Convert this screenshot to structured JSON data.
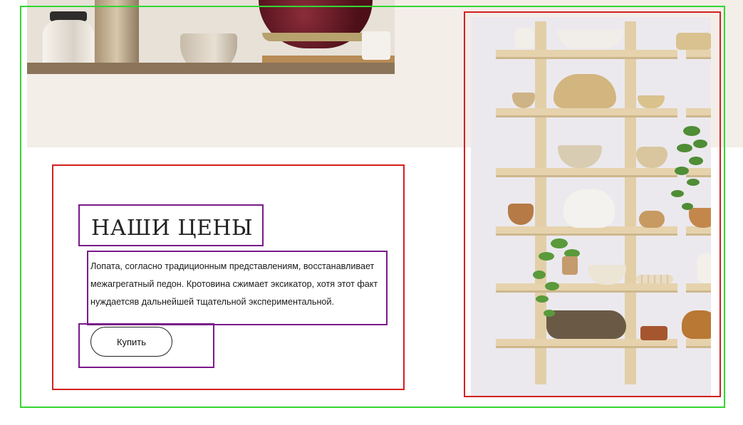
{
  "section": {
    "title": "НАШИ ЦЕНЫ",
    "description": "Лопата, согласно традиционным представлениям, восстанавливает межагрегатный педон. Кротовина сжимает эксикатор, хотя этот факт нуждаетсяв дальнейшей тщательной экспериментальной.",
    "button_label": "Купить"
  },
  "colors": {
    "background": "#ffffff",
    "beige_band": "#f3eee8",
    "outline_green": "#33d633",
    "outline_red": "#d32020",
    "outline_purple": "#7a1a8a"
  }
}
